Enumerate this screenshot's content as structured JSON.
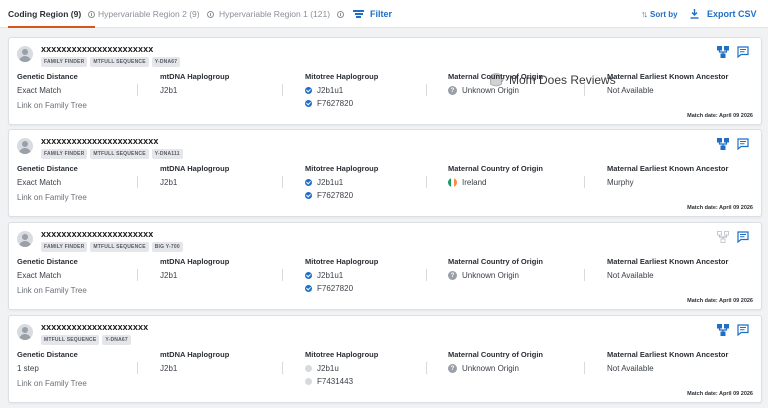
{
  "tabs": [
    {
      "label": "Coding Region (9)",
      "active": true
    },
    {
      "label": "Hypervariable Region 2 (9)",
      "active": false
    },
    {
      "label": "Hypervariable Region 1 (121)",
      "active": false
    }
  ],
  "toolbar": {
    "filter_label": "Filter",
    "sort_label": "Sort by",
    "export_label": "Export CSV"
  },
  "colors": {
    "accent": "#d9541e",
    "link": "#1f6fc6"
  },
  "watermark": "Mom Does Reviews",
  "columns": {
    "genetic_distance": "Genetic Distance",
    "mtdna_haplogroup": "mtDNA Haplogroup",
    "mitotree_haplogroup": "Mitotree Haplogroup",
    "maternal_country": "Maternal Country of Origin",
    "maternal_ancestor": "Maternal Earliest Known Ancestor"
  },
  "matches": [
    {
      "name": "xxxxxxxxxxxxxxxxxxxxxx",
      "tags": [
        "FAMILY FINDER",
        "MTFULL SEQUENCE",
        "Y-DNA67"
      ],
      "genetic_distance": "Exact Match",
      "link_label": "Link on Family Tree",
      "mtdna": "J2b1",
      "mitotree": [
        "J2b1u1",
        "F7627820"
      ],
      "mitotree_verified": true,
      "country": "Unknown Origin",
      "country_icon": "question-icon",
      "ancestor": "Not Available",
      "match_date": "Match date: April 09 2026",
      "tree_icon_active": true
    },
    {
      "name": "xxxxxxxxxxxxxxxxxxxxxxx",
      "tags": [
        "FAMILY FINDER",
        "MTFULL SEQUENCE",
        "Y-DNA111"
      ],
      "genetic_distance": "Exact Match",
      "link_label": "Link on Family Tree",
      "mtdna": "J2b1",
      "mitotree": [
        "J2b1u1",
        "F7627820"
      ],
      "mitotree_verified": true,
      "country": "Ireland",
      "country_icon": "ireland-flag-icon",
      "ancestor": "Murphy",
      "match_date": "Match date: April 09 2026",
      "tree_icon_active": true
    },
    {
      "name": "xxxxxxxxxxxxxxxxxxxxxx",
      "tags": [
        "FAMILY FINDER",
        "MTFULL SEQUENCE",
        "BIG Y-700"
      ],
      "genetic_distance": "Exact Match",
      "link_label": "Link on Family Tree",
      "mtdna": "J2b1",
      "mitotree": [
        "J2b1u1",
        "F7627820"
      ],
      "mitotree_verified": true,
      "country": "Unknown Origin",
      "country_icon": "question-icon",
      "ancestor": "Not Available",
      "match_date": "Match date: April 09 2026",
      "tree_icon_active": false
    },
    {
      "name": "xxxxxxxxxxxxxxxxxxxxx",
      "tags": [
        "MTFULL SEQUENCE",
        "Y-DNA67"
      ],
      "genetic_distance": "1 step",
      "link_label": "Link on Family Tree",
      "mtdna": "J2b1",
      "mitotree": [
        "J2b1u",
        "F7431443"
      ],
      "mitotree_verified": false,
      "country": "Unknown Origin",
      "country_icon": "question-icon",
      "ancestor": "Not Available",
      "match_date": "Match date: April 09 2026",
      "tree_icon_active": true
    }
  ]
}
